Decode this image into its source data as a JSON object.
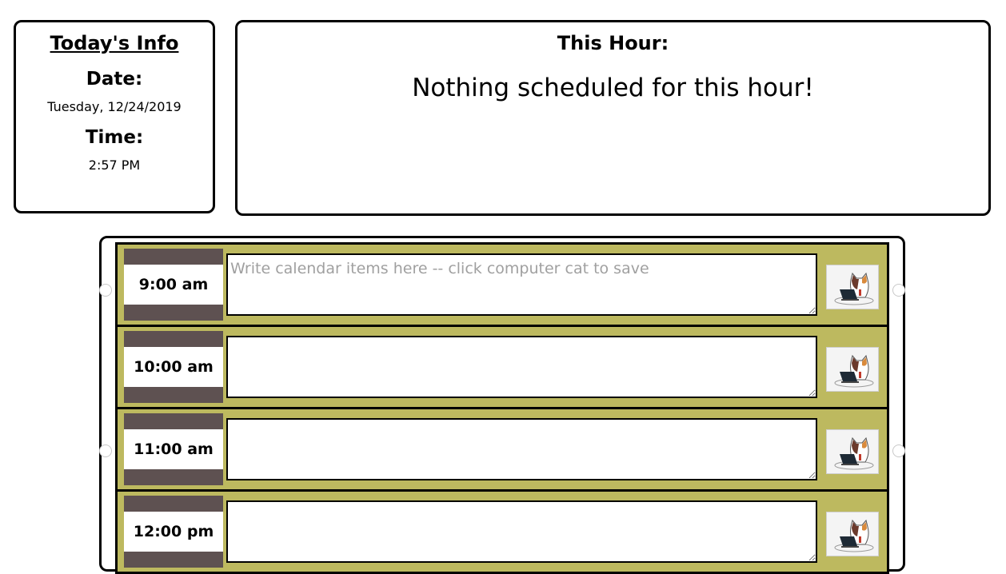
{
  "info": {
    "title": "Today's Info",
    "date_label": "Date:",
    "date_value": "Tuesday, 12/24/2019",
    "time_label": "Time:",
    "time_value": "2:57 PM"
  },
  "this_hour": {
    "title": "This Hour:",
    "message": "Nothing scheduled for this hour!"
  },
  "planner": {
    "placeholder": "Write calendar items here -- click computer cat to save",
    "save_icon": "computer-cat-icon",
    "rows": [
      {
        "time": "9:00 am",
        "value": ""
      },
      {
        "time": "10:00 am",
        "value": ""
      },
      {
        "time": "11:00 am",
        "value": ""
      },
      {
        "time": "12:00 pm",
        "value": ""
      }
    ]
  },
  "colors": {
    "row_background": "#bdb95f",
    "time_block_band": "#5e5151",
    "border": "#000000"
  }
}
